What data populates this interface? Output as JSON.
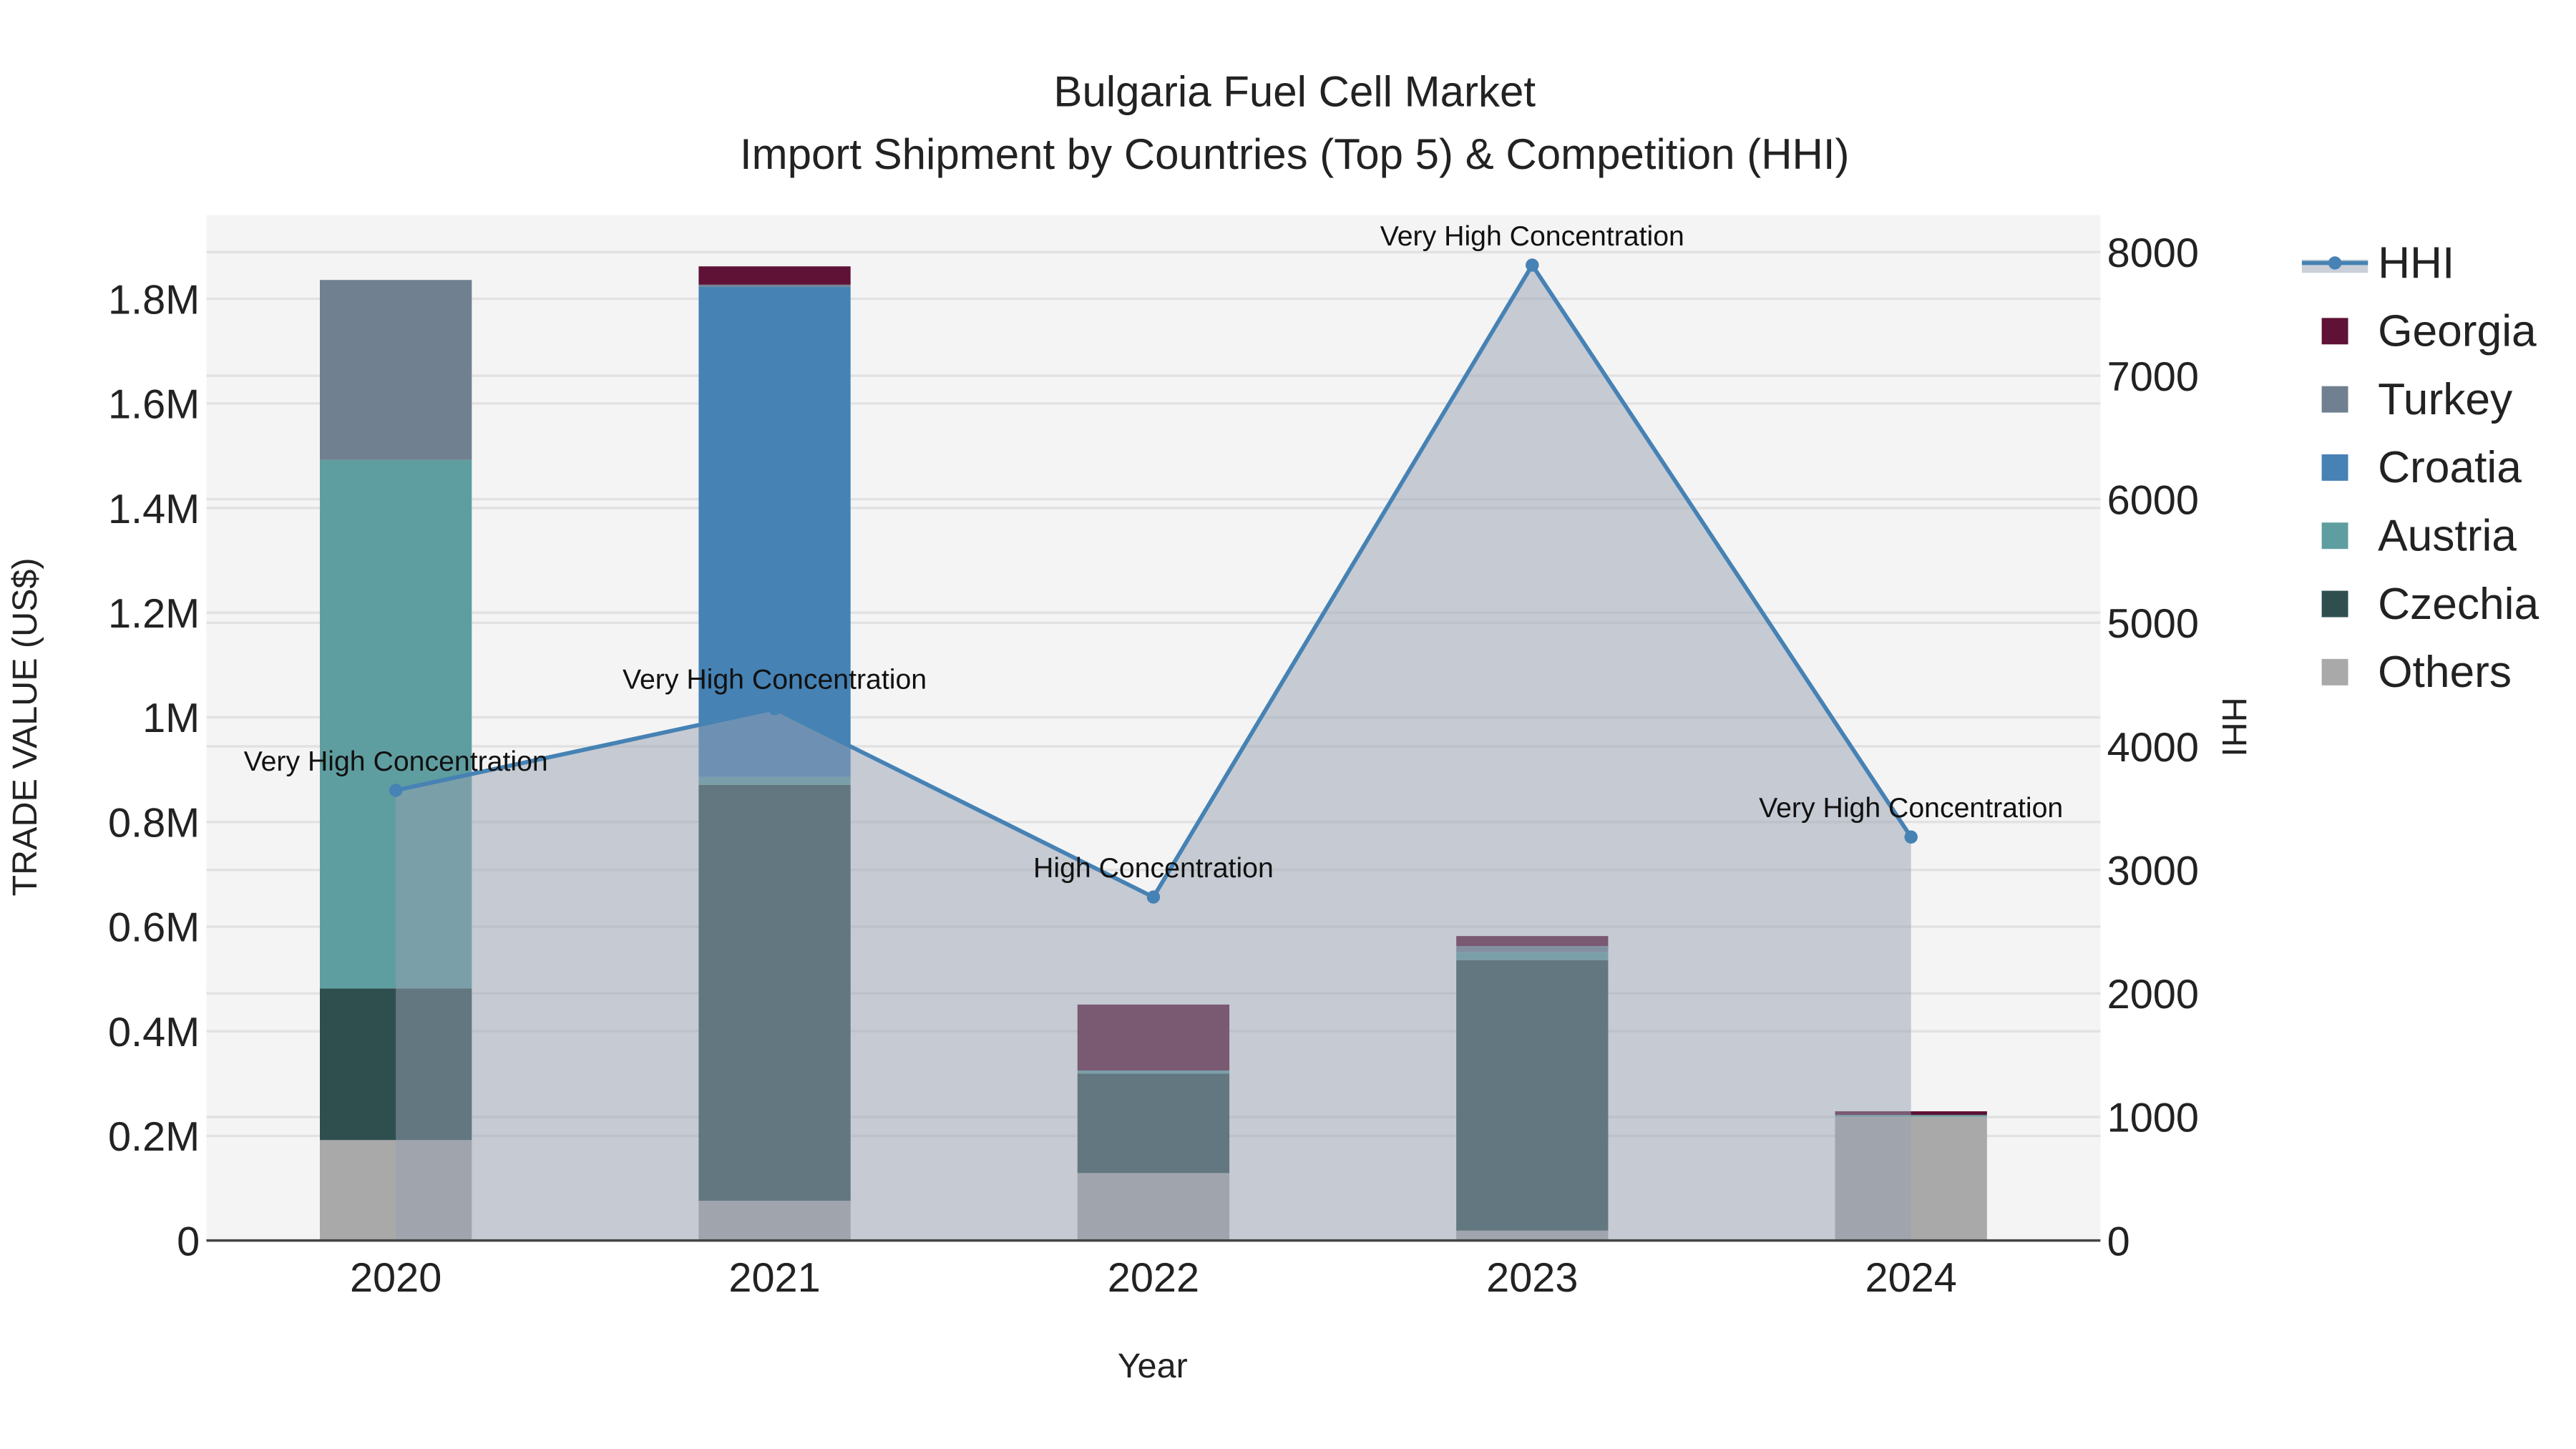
{
  "chart_data": {
    "type": "bar",
    "title": "Bulgaria Fuel Cell Market",
    "subtitle": "Import Shipment by Countries (Top 5) & Competition (HHI)",
    "xlabel": "Year",
    "ylabel": "TRADE VALUE (US$)",
    "y2label": "HHI",
    "categories": [
      "2020",
      "2021",
      "2022",
      "2023",
      "2024"
    ],
    "ylim": [
      0,
      1960000
    ],
    "y2lim": [
      0,
      8300
    ],
    "yticks": [
      0,
      200000,
      400000,
      600000,
      800000,
      1000000,
      1200000,
      1400000,
      1600000,
      1800000
    ],
    "ytick_labels": [
      "0",
      "0.2M",
      "0.4M",
      "0.6M",
      "0.8M",
      "1M",
      "1.2M",
      "1.4M",
      "1.6M",
      "1.8M"
    ],
    "y2ticks": [
      0,
      1000,
      2000,
      3000,
      4000,
      5000,
      6000,
      7000,
      8000
    ],
    "y2tick_labels": [
      "0",
      "1000",
      "2000",
      "3000",
      "4000",
      "5000",
      "6000",
      "7000",
      "8000"
    ],
    "grid": true,
    "legend_position": "right",
    "series": [
      {
        "name": "Others",
        "color": "#a9a9a9",
        "values": [
          192000,
          76000,
          129000,
          19000,
          237000
        ]
      },
      {
        "name": "Czechia",
        "color": "#2f4f4f",
        "values": [
          290000,
          795000,
          190000,
          517000,
          0
        ]
      },
      {
        "name": "Austria",
        "color": "#5f9ea0",
        "values": [
          1010000,
          15000,
          6000,
          15000,
          3000
        ]
      },
      {
        "name": "Croatia",
        "color": "#4682b4",
        "values": [
          0,
          937000,
          0,
          0,
          0
        ]
      },
      {
        "name": "Turkey",
        "color": "#708090",
        "values": [
          344000,
          4000,
          0,
          12000,
          0
        ]
      },
      {
        "name": "Georgia",
        "color": "#5f1235",
        "values": [
          0,
          35000,
          126000,
          19000,
          7000
        ]
      }
    ],
    "hhi": {
      "name": "HHI",
      "color": "#4682b4",
      "values": [
        3644,
        4305,
        2780,
        7895,
        3266
      ],
      "annotations": [
        "Very High Concentration",
        "Very High Concentration",
        "High Concentration",
        "Very High Concentration",
        "Very High Concentration"
      ]
    },
    "legend_order": [
      "HHI",
      "Georgia",
      "Turkey",
      "Croatia",
      "Austria",
      "Czechia",
      "Others"
    ]
  }
}
